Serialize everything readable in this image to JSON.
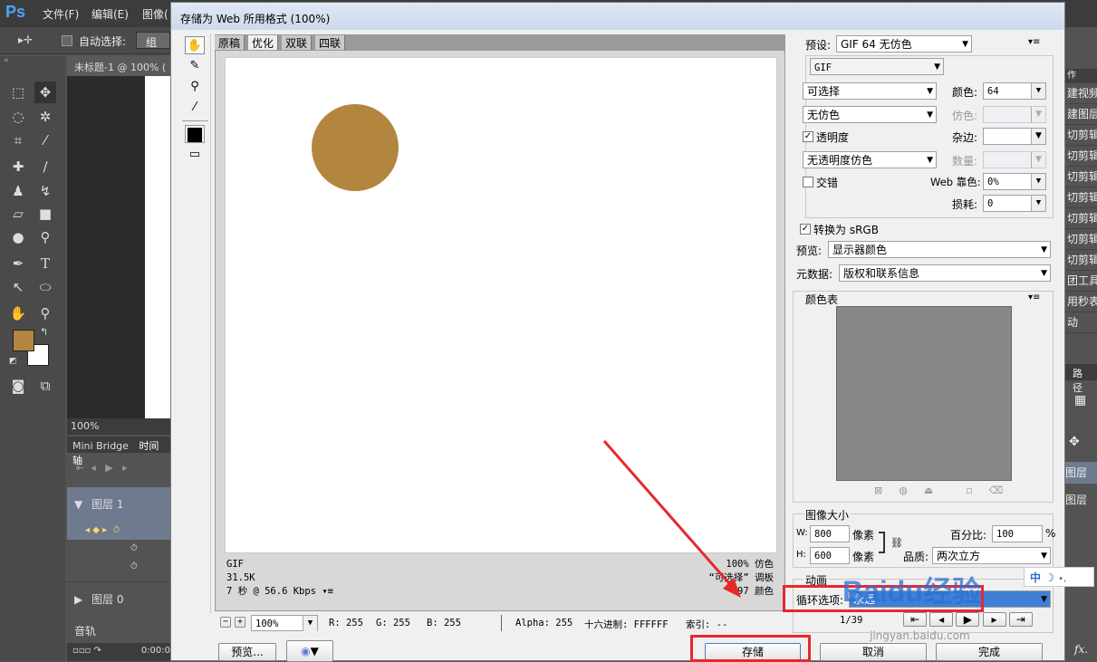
{
  "photoshop": {
    "logo": "Ps",
    "menu": [
      "文件(F)",
      "编辑(E)",
      "图像("
    ],
    "options": {
      "auto_select_label": "自动选择:",
      "auto_select_value": "组"
    },
    "doc_tab": "未标题-1 @ 100% (",
    "zoom": "100%",
    "panels": {
      "mini_bridge": "Mini Bridge",
      "timeline": "时间轴"
    },
    "timeline_layers": [
      "图层 1",
      "图层 0"
    ],
    "audio_track": "音轨",
    "time": "0:00:0",
    "foreground_color": "#b3863f",
    "background_color": "#ffffff",
    "right_panel_items": [
      "作",
      "建视频",
      "建图层",
      "切剪辑",
      "切剪辑",
      "切剪辑",
      "切剪辑",
      "切剪辑",
      "切剪辑",
      "切剪辑",
      "团工具",
      "用秒表",
      "动"
    ],
    "right_panel_tabs": [
      "路径",
      "图层",
      "图层"
    ]
  },
  "dialog": {
    "title": "存储为 Web 所用格式 (100%)",
    "tabs": [
      "原稿",
      "优化",
      "双联",
      "四联"
    ],
    "active_tab": "优化",
    "preview": {
      "circle_color": "#b3863f",
      "info_left": [
        "GIF",
        "31.5K",
        "7 秒 @ 56.6 Kbps"
      ],
      "info_right": [
        "100% 仿色",
        "“可选择” 调板",
        "97 颜色"
      ]
    },
    "bottom": {
      "zoom": "100%",
      "r": "R: 255",
      "g": "G: 255",
      "b": "B: 255",
      "alpha": "Alpha: 255",
      "hex": "十六进制: FFFFFF",
      "index": "索引: --"
    },
    "buttons": {
      "preview": "预览...",
      "save": "存储",
      "cancel": "取消",
      "done": "完成"
    },
    "settings": {
      "preset_label": "预设:",
      "preset": "GIF 64 无仿色",
      "format": "GIF",
      "reduction": "可选择",
      "colors_label": "颜色:",
      "colors": "64",
      "dither_algo": "无仿色",
      "dither_label": "仿色:",
      "dither": "",
      "transparency_label": "透明度",
      "matte_label": "杂边:",
      "matte": "",
      "trans_dither": "无透明度仿色",
      "amount_label": "数量:",
      "amount": "",
      "interlaced_label": "交错",
      "web_snap_label": "Web 靠色:",
      "web_snap": "0%",
      "lossy_label": "损耗:",
      "lossy": "0",
      "convert_srgb_label": "转换为 sRGB",
      "preview_label": "预览:",
      "preview_value": "显示器颜色",
      "metadata_label": "元数据:",
      "metadata": "版权和联系信息",
      "color_table_label": "颜色表",
      "image_size_label": "图像大小",
      "w_label": "W:",
      "w": "800",
      "h_label": "H:",
      "h": "600",
      "px": "像素",
      "percent_label": "百分比:",
      "percent": "100",
      "percent_unit": "%",
      "quality_label": "品质:",
      "quality": "两次立方",
      "animation_label": "动画",
      "loop_label": "循环选项:",
      "loop": "永远",
      "frame_counter": "1/39"
    }
  },
  "watermark": {
    "text": "Baidu经验",
    "url": "jingyan.baidu.com",
    "ime": "中"
  }
}
